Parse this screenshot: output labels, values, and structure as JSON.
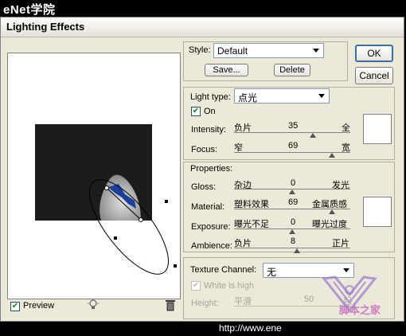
{
  "brand": "eNet学院",
  "window": {
    "title": "Lighting Effects"
  },
  "style": {
    "label": "Style:",
    "value": "Default",
    "save": "Save...",
    "delete": "Delete"
  },
  "buttons": {
    "ok": "OK",
    "cancel": "Cancel"
  },
  "light": {
    "type_label": "Light type:",
    "type_value": "点光",
    "on_label": "On",
    "on_checked": true,
    "intensity": {
      "label": "Intensity:",
      "left": "负片",
      "value": "35",
      "right": "全",
      "level": 0.68
    },
    "focus": {
      "label": "Focus:",
      "left": "窄",
      "value": "69",
      "right": "宽",
      "level": 0.85
    }
  },
  "properties": {
    "title": "Properties:",
    "gloss": {
      "label": "Gloss:",
      "left": "杂边",
      "value": "0",
      "right": "发光",
      "level": 0.5
    },
    "material": {
      "label": "Material:",
      "left": "塑料效果",
      "value": "69",
      "right": "金属质感",
      "level": 0.85
    },
    "exposure": {
      "label": "Exposure:",
      "left": "曝光不足",
      "value": "0",
      "right": "曝光过度",
      "level": 0.5
    },
    "ambience": {
      "label": "Ambience:",
      "left": "负片",
      "value": "8",
      "right": "正片",
      "level": 0.54
    }
  },
  "texture": {
    "label": "Texture Channel:",
    "value": "无",
    "white_is_high": "White is high",
    "height_label": "Height:",
    "height_left": "平滑",
    "height_value": "50",
    "height_right": "起"
  },
  "preview_label": "Preview",
  "footer_url": "http://www.ene",
  "watermark": "脚本之家",
  "colors": {
    "dialog_bg": "#ece9d8",
    "preview_dark": "#1c1c1c",
    "light_blue": "#1a3f9c"
  }
}
